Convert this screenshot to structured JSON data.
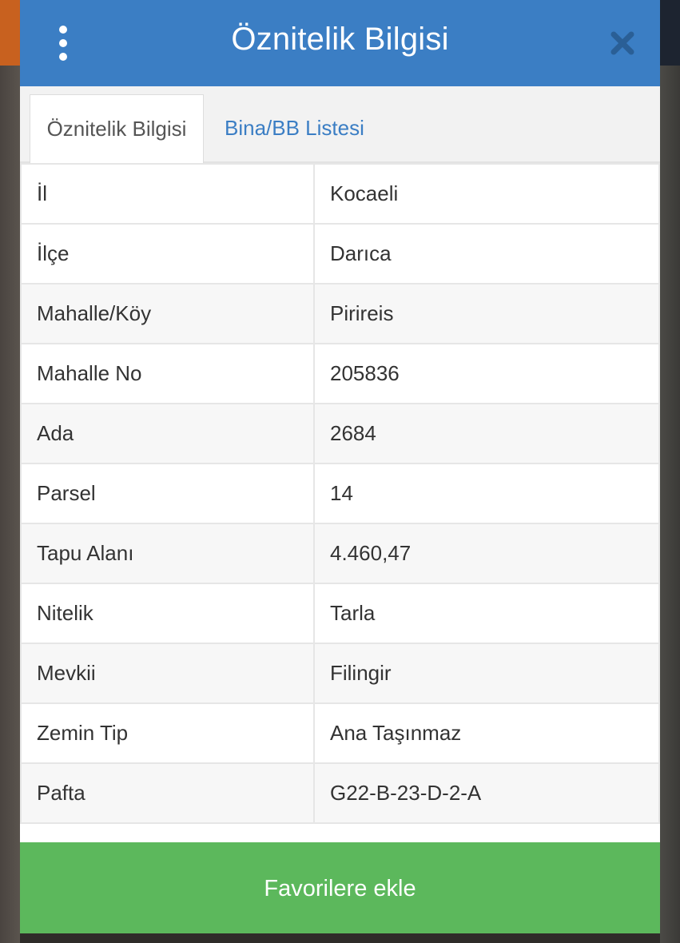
{
  "header": {
    "title": "Öznitelik Bilgisi",
    "menu_icon": "more-vertical-icon",
    "close_icon": "close-icon"
  },
  "tabs": [
    {
      "label": "Öznitelik Bilgisi",
      "active": true
    },
    {
      "label": "Bina/BB Listesi",
      "active": false
    }
  ],
  "attributes": [
    {
      "key": "İl",
      "value": "Kocaeli"
    },
    {
      "key": "İlçe",
      "value": "Darıca"
    },
    {
      "key": "Mahalle/Köy",
      "value": "Pirireis"
    },
    {
      "key": "Mahalle No",
      "value": "205836"
    },
    {
      "key": "Ada",
      "value": "2684"
    },
    {
      "key": "Parsel",
      "value": "14"
    },
    {
      "key": "Tapu Alanı",
      "value": "4.460,47"
    },
    {
      "key": "Nitelik",
      "value": "Tarla"
    },
    {
      "key": "Mevkii",
      "value": "Filingir"
    },
    {
      "key": "Zemin Tip",
      "value": "Ana Taşınmaz"
    },
    {
      "key": "Pafta",
      "value": "G22-B-23-D-2-A"
    }
  ],
  "footer": {
    "favorite_label": "Favorilere ekle"
  },
  "colors": {
    "header": "#3b7ec4",
    "button": "#5cb85c",
    "tab_link": "#3b7ec4"
  }
}
